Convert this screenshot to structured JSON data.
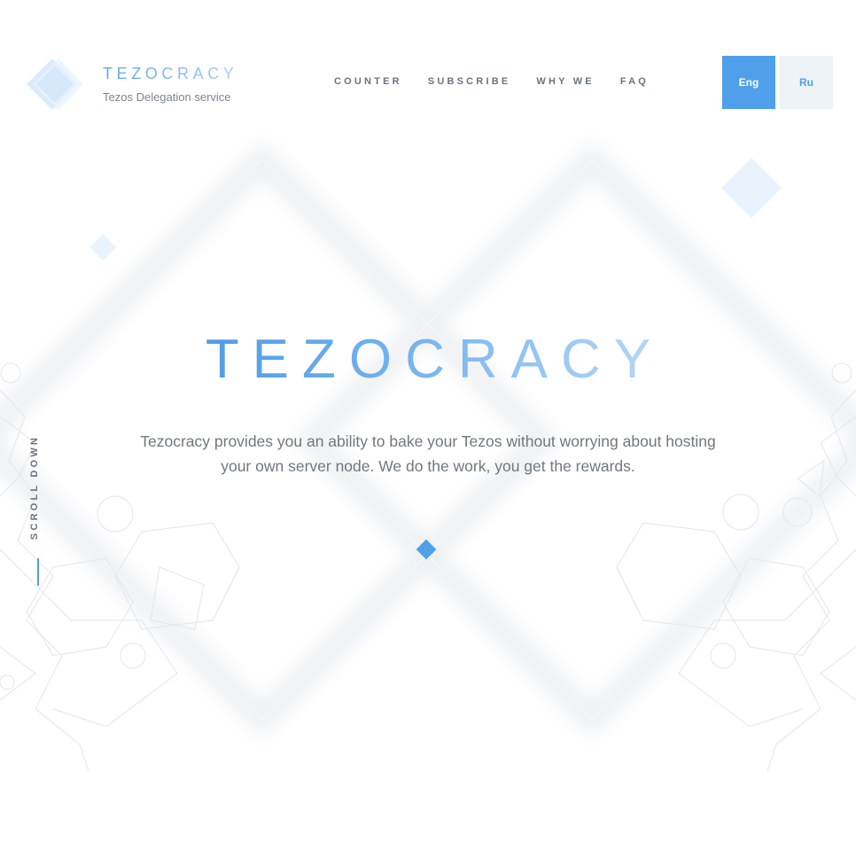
{
  "header": {
    "logo_title": "TEZOCRACY",
    "logo_subtitle": "Tezos Delegation service"
  },
  "nav": {
    "items": [
      {
        "label": "COUNTER"
      },
      {
        "label": "SUBSCRIBE"
      },
      {
        "label": "WHY WE"
      },
      {
        "label": "FAQ"
      }
    ]
  },
  "language": {
    "options": [
      "Eng",
      "Ru"
    ],
    "selected": "Eng"
  },
  "hero": {
    "title": "TEZOCRACY",
    "description": "Tezocracy provides you an ability to bake your Tezos without worrying about hosting your own server node. We do the work, you get the rewards."
  },
  "scroll": {
    "label": "SCROLL DOWN"
  },
  "colors": {
    "accent": "#4f9feb",
    "text": "#707780",
    "nav_text": "#6c737c",
    "lang_inactive_bg": "#eef3f8"
  },
  "icons": {
    "logo": "diamond-logo-icon",
    "hero": "diamond-icon"
  }
}
